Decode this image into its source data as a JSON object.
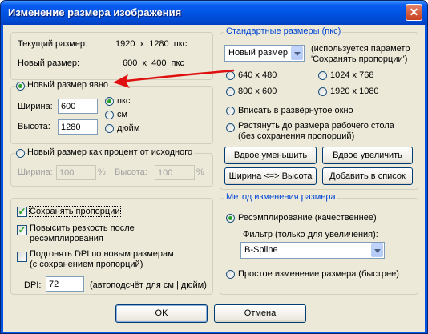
{
  "window": {
    "title": "Изменение размера изображения",
    "close_glyph": "✕"
  },
  "current": {
    "current_label": "Текущий размер:",
    "current_value": "1920  x  1280  пкс",
    "new_label": "Новый размер:",
    "new_value": "600  x  400  пкс"
  },
  "explicit": {
    "radio_label": "Новый размер явно",
    "width_label": "Ширина:",
    "width_value": "600",
    "height_label": "Высота:",
    "height_value": "1280",
    "unit_px": "пкс",
    "unit_cm": "см",
    "unit_inch": "дюйм"
  },
  "percent": {
    "radio_label": "Новый размер как процент от исходного",
    "width_label": "Ширина:",
    "width_value": "100",
    "percent_sign": "%",
    "height_label": "Высота:",
    "height_value": "100",
    "percent_sign2": "%"
  },
  "options": {
    "keep_ratio": "Сохранять пропорции",
    "sharpen_line1": "Повысить резкость после",
    "sharpen_line2": "ресэмплирования",
    "dpi_line1": "Подгонять DPI по новым размерам",
    "dpi_line2": "(с сохранением пропорций)",
    "dpi_label": "DPI:",
    "dpi_value": "72",
    "dpi_note": "(автоподсчёт для см | дюйм)"
  },
  "standard": {
    "group_title": "Стандартные размеры (пкс)",
    "select_value": "Новый размер",
    "note_line1": "(используется параметр",
    "note_line2": "'Сохранять пропорции')",
    "s640": "640 x 480",
    "s1024": "1024 x 768",
    "s800": "800 x 600",
    "s1920": "1920 x 1080",
    "fit_window": "Вписать в развёрнутое окно",
    "stretch_line1": "Растянуть до размера рабочего стола",
    "stretch_line2": "(без сохранения пропорций)",
    "btn_halve": "Вдвое уменьшить",
    "btn_double": "Вдвое увеличить",
    "btn_swap": "Ширина <=> Высота",
    "btn_add": "Добавить в список"
  },
  "method": {
    "group_title": "Метод изменения размера",
    "resample": "Ресэмплирование (качественнее)",
    "filter_label": "Фильтр (только для увеличения):",
    "filter_value": "B-Spline",
    "simple": "Простое изменение размера (быстрее)"
  },
  "footer": {
    "ok": "OK",
    "cancel": "Отмена"
  },
  "colors": {
    "annotation_arrow": "#e01010",
    "title_bar": "#0054e3",
    "group_title": "#0046d5"
  }
}
